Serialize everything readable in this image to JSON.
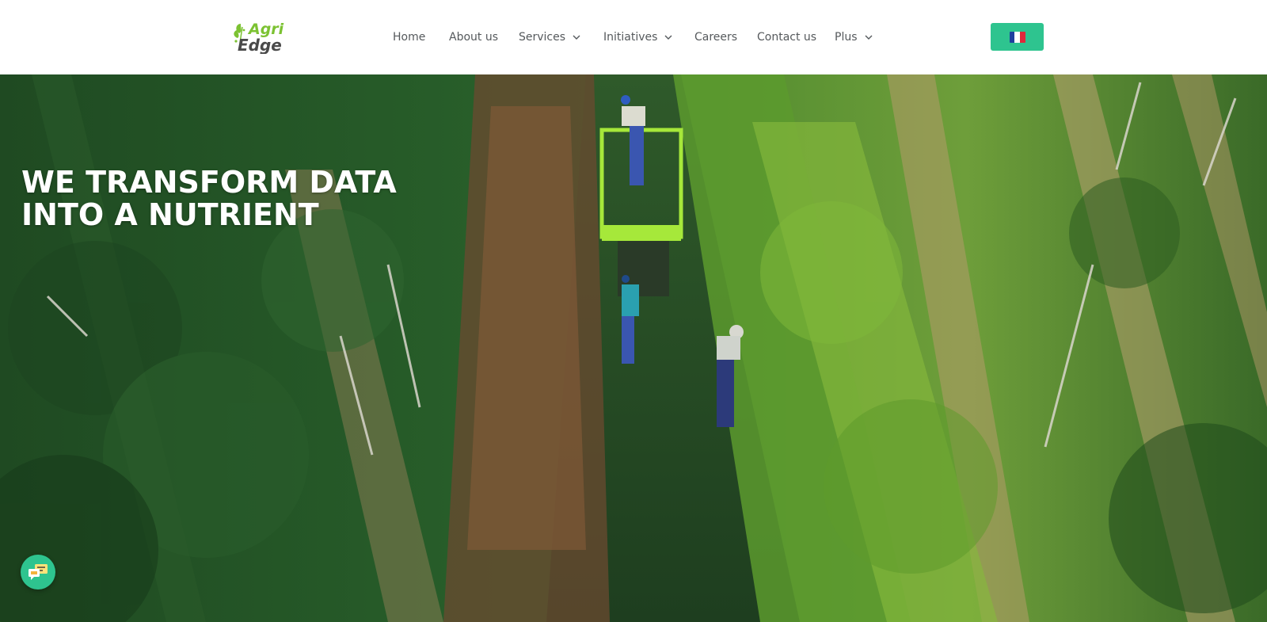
{
  "brand": {
    "logo_line1": "Agri",
    "logo_line2": "Edge",
    "logo_colors": {
      "agri": "#7cc232",
      "edge": "#4a4a4a"
    }
  },
  "nav": {
    "items": [
      {
        "label": "Home",
        "has_dropdown": false
      },
      {
        "label": "About us",
        "has_dropdown": false
      },
      {
        "label": "Services",
        "has_dropdown": true
      },
      {
        "label": "Initiatives",
        "has_dropdown": true
      },
      {
        "label": "Careers",
        "has_dropdown": false
      },
      {
        "label": "Contact us",
        "has_dropdown": false
      },
      {
        "label": "Plus",
        "has_dropdown": true
      }
    ],
    "dropdown_icon": "chevron-down-icon",
    "text_color": "#55595c"
  },
  "language_switcher": {
    "icon": "france-flag-icon",
    "background": "#2ec48f"
  },
  "hero": {
    "title_line1": "WE TRANSFORM DATA",
    "title_line2": "INTO A NUTRIENT"
  },
  "chat_widget": {
    "icon": "chat-icon",
    "background": "#2ec48f"
  }
}
